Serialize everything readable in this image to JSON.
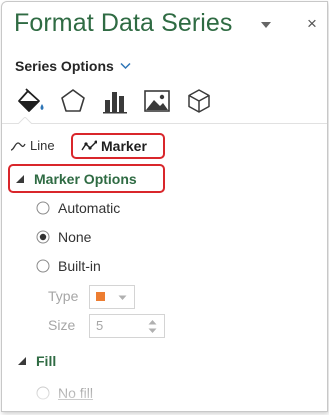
{
  "pane": {
    "title": "Format Data Series",
    "dropdown_icon": "caret-down-icon",
    "close_symbol": "×",
    "series_options_label": "Series Options"
  },
  "category_icons": [
    "paint-bucket-icon",
    "pentagon-icon",
    "bar-chart-icon",
    "picture-icon",
    "cube-icon"
  ],
  "subtabs": {
    "line_label": "Line",
    "marker_label": "Marker",
    "selected": "Marker"
  },
  "marker_options": {
    "header": "Marker Options",
    "expanded": true,
    "radios": [
      {
        "label": "Automatic",
        "selected": false
      },
      {
        "label": "None",
        "selected": true
      },
      {
        "label": "Built-in",
        "selected": false
      }
    ],
    "type_label": "Type",
    "type_swatch_color": "#ED7D31",
    "size_label": "Size",
    "size_value": "5"
  },
  "fill": {
    "header": "Fill",
    "expanded": true,
    "first_option": "No fill"
  },
  "colors": {
    "title_green": "#2F6B43",
    "highlight_red": "#D9262B",
    "accent_blue": "#2E75B6"
  }
}
